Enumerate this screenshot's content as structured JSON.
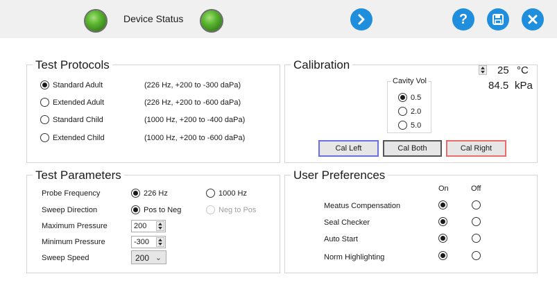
{
  "header": {
    "title": "Device Status",
    "indicator_color": "#5cb832",
    "button_color": "#1f8fdd"
  },
  "protocols": {
    "legend": "Test Protocols",
    "items": [
      {
        "label": "Standard Adult",
        "desc": "(226 Hz, +200 to -300 daPa)",
        "selected": true
      },
      {
        "label": "Extended Adult",
        "desc": "(226 Hz, +200 to -600 daPa)",
        "selected": false
      },
      {
        "label": "Standard Child",
        "desc": "(1000 Hz, +200 to -400 daPa)",
        "selected": false
      },
      {
        "label": "Extended Child",
        "desc": "(1000 Hz, +200 to -600 daPa)",
        "selected": false
      }
    ]
  },
  "calibration": {
    "legend": "Calibration",
    "temperature": "25",
    "temp_unit": "°C",
    "pressure": "84.5",
    "pressure_unit": "kPa",
    "cavity_legend": "Cavity Vol",
    "cavity_options": [
      {
        "label": "0.5",
        "selected": true
      },
      {
        "label": "2.0",
        "selected": false
      },
      {
        "label": "5.0",
        "selected": false
      }
    ],
    "cal_left": "Cal Left",
    "cal_both": "Cal Both",
    "cal_right": "Cal Right"
  },
  "parameters": {
    "legend": "Test Parameters",
    "probe_label": "Probe Frequency",
    "probe_opt1": "226 Hz",
    "probe_opt2": "1000 Hz",
    "sweep_dir_label": "Sweep Direction",
    "sweep_opt1": "Pos to Neg",
    "sweep_opt2": "Neg to Pos",
    "max_label": "Maximum Pressure",
    "max_value": "200",
    "min_label": "Minimum Pressure",
    "min_value": "-300",
    "speed_label": "Sweep Speed",
    "speed_value": "200"
  },
  "preferences": {
    "legend": "User Preferences",
    "col_on": "On",
    "col_off": "Off",
    "items": [
      {
        "label": "Meatus Compensation",
        "on": true
      },
      {
        "label": "Seal Checker",
        "on": true
      },
      {
        "label": "Auto Start",
        "on": true
      },
      {
        "label": "Norm Highlighting",
        "on": true
      }
    ]
  }
}
